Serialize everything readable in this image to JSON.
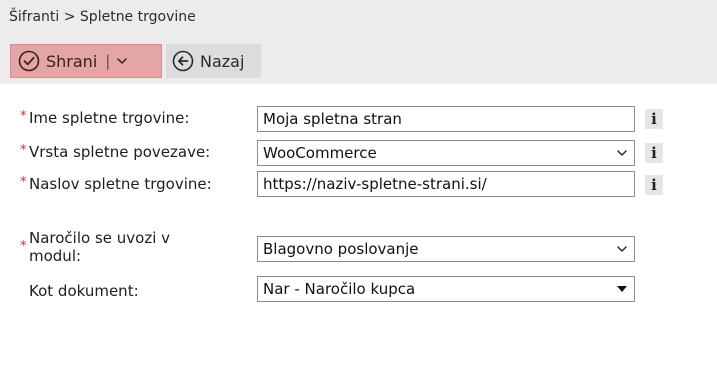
{
  "breadcrumb": "Šifranti > Spletne trgovine",
  "toolbar": {
    "save_label": "Shrani",
    "save_separator": "|",
    "back_label": "Nazaj"
  },
  "form": {
    "required_marker": "*",
    "info_glyph": "i",
    "store_name": {
      "label": "Ime spletne trgovine:",
      "value": "Moja spletna stran"
    },
    "link_type": {
      "label": "Vrsta spletne povezave:",
      "value": "WooCommerce"
    },
    "store_url": {
      "label": "Naslov spletne trgovine:",
      "value": "https://naziv-spletne-strani.si/"
    },
    "order_module": {
      "label_line1": "Naročilo se uvozi v",
      "label_line2": "modul:",
      "value": "Blagovno poslovanje"
    },
    "document": {
      "label": "Kot dokument:",
      "value": "Nar - Naročilo kupca"
    }
  },
  "colors": {
    "save_button_bg": "#e3a5a6",
    "toolbar_bg": "#ececec",
    "required": "#c0392b"
  },
  "icons": {
    "save": "check-circle-icon",
    "save_dropdown": "chevron-down-icon",
    "back": "arrow-left-circle-icon",
    "select": "chevron-down-icon",
    "select_filled": "caret-down-icon",
    "info": "info-icon"
  }
}
